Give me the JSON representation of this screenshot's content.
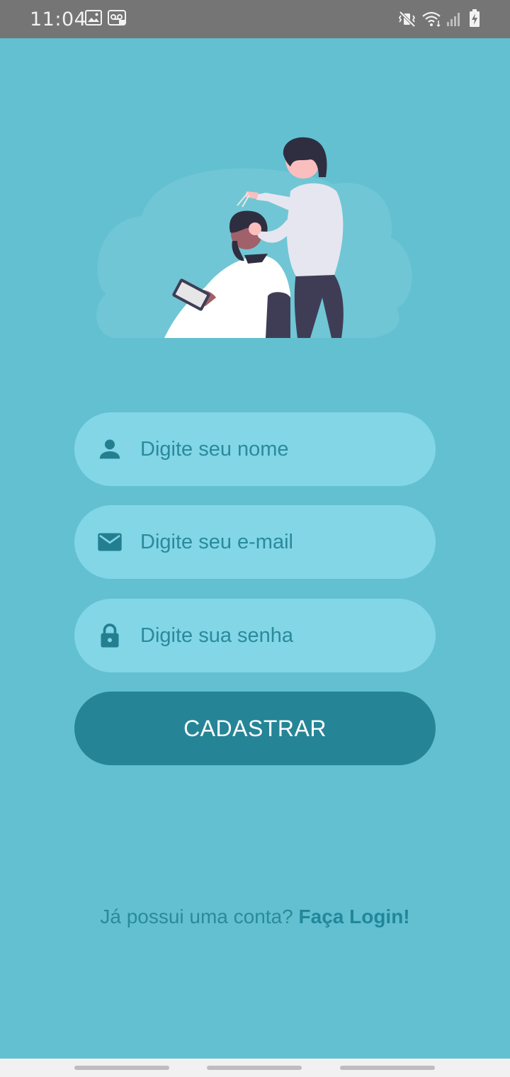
{
  "status_bar": {
    "time": "11:04",
    "icons_left": [
      "image-icon",
      "voicemail-icon"
    ],
    "icons_right": [
      "mute-vibrate-icon",
      "wifi-icon",
      "signal-icon",
      "battery-charging-icon"
    ]
  },
  "illustration": {
    "name": "barber-cutting-hair-illustration"
  },
  "form": {
    "name_placeholder": "Digite seu nome",
    "email_placeholder": "Digite seu e-mail",
    "password_placeholder": "Digite sua senha",
    "name_value": "",
    "email_value": "",
    "password_value": "",
    "submit_label": "CADASTRAR"
  },
  "footer": {
    "question": "Já possui uma conta?",
    "login_link": "Faça Login!"
  },
  "colors": {
    "background": "#62c0d1",
    "field": "#82d6e6",
    "primary": "#258596",
    "text": "#2a8a9c"
  }
}
